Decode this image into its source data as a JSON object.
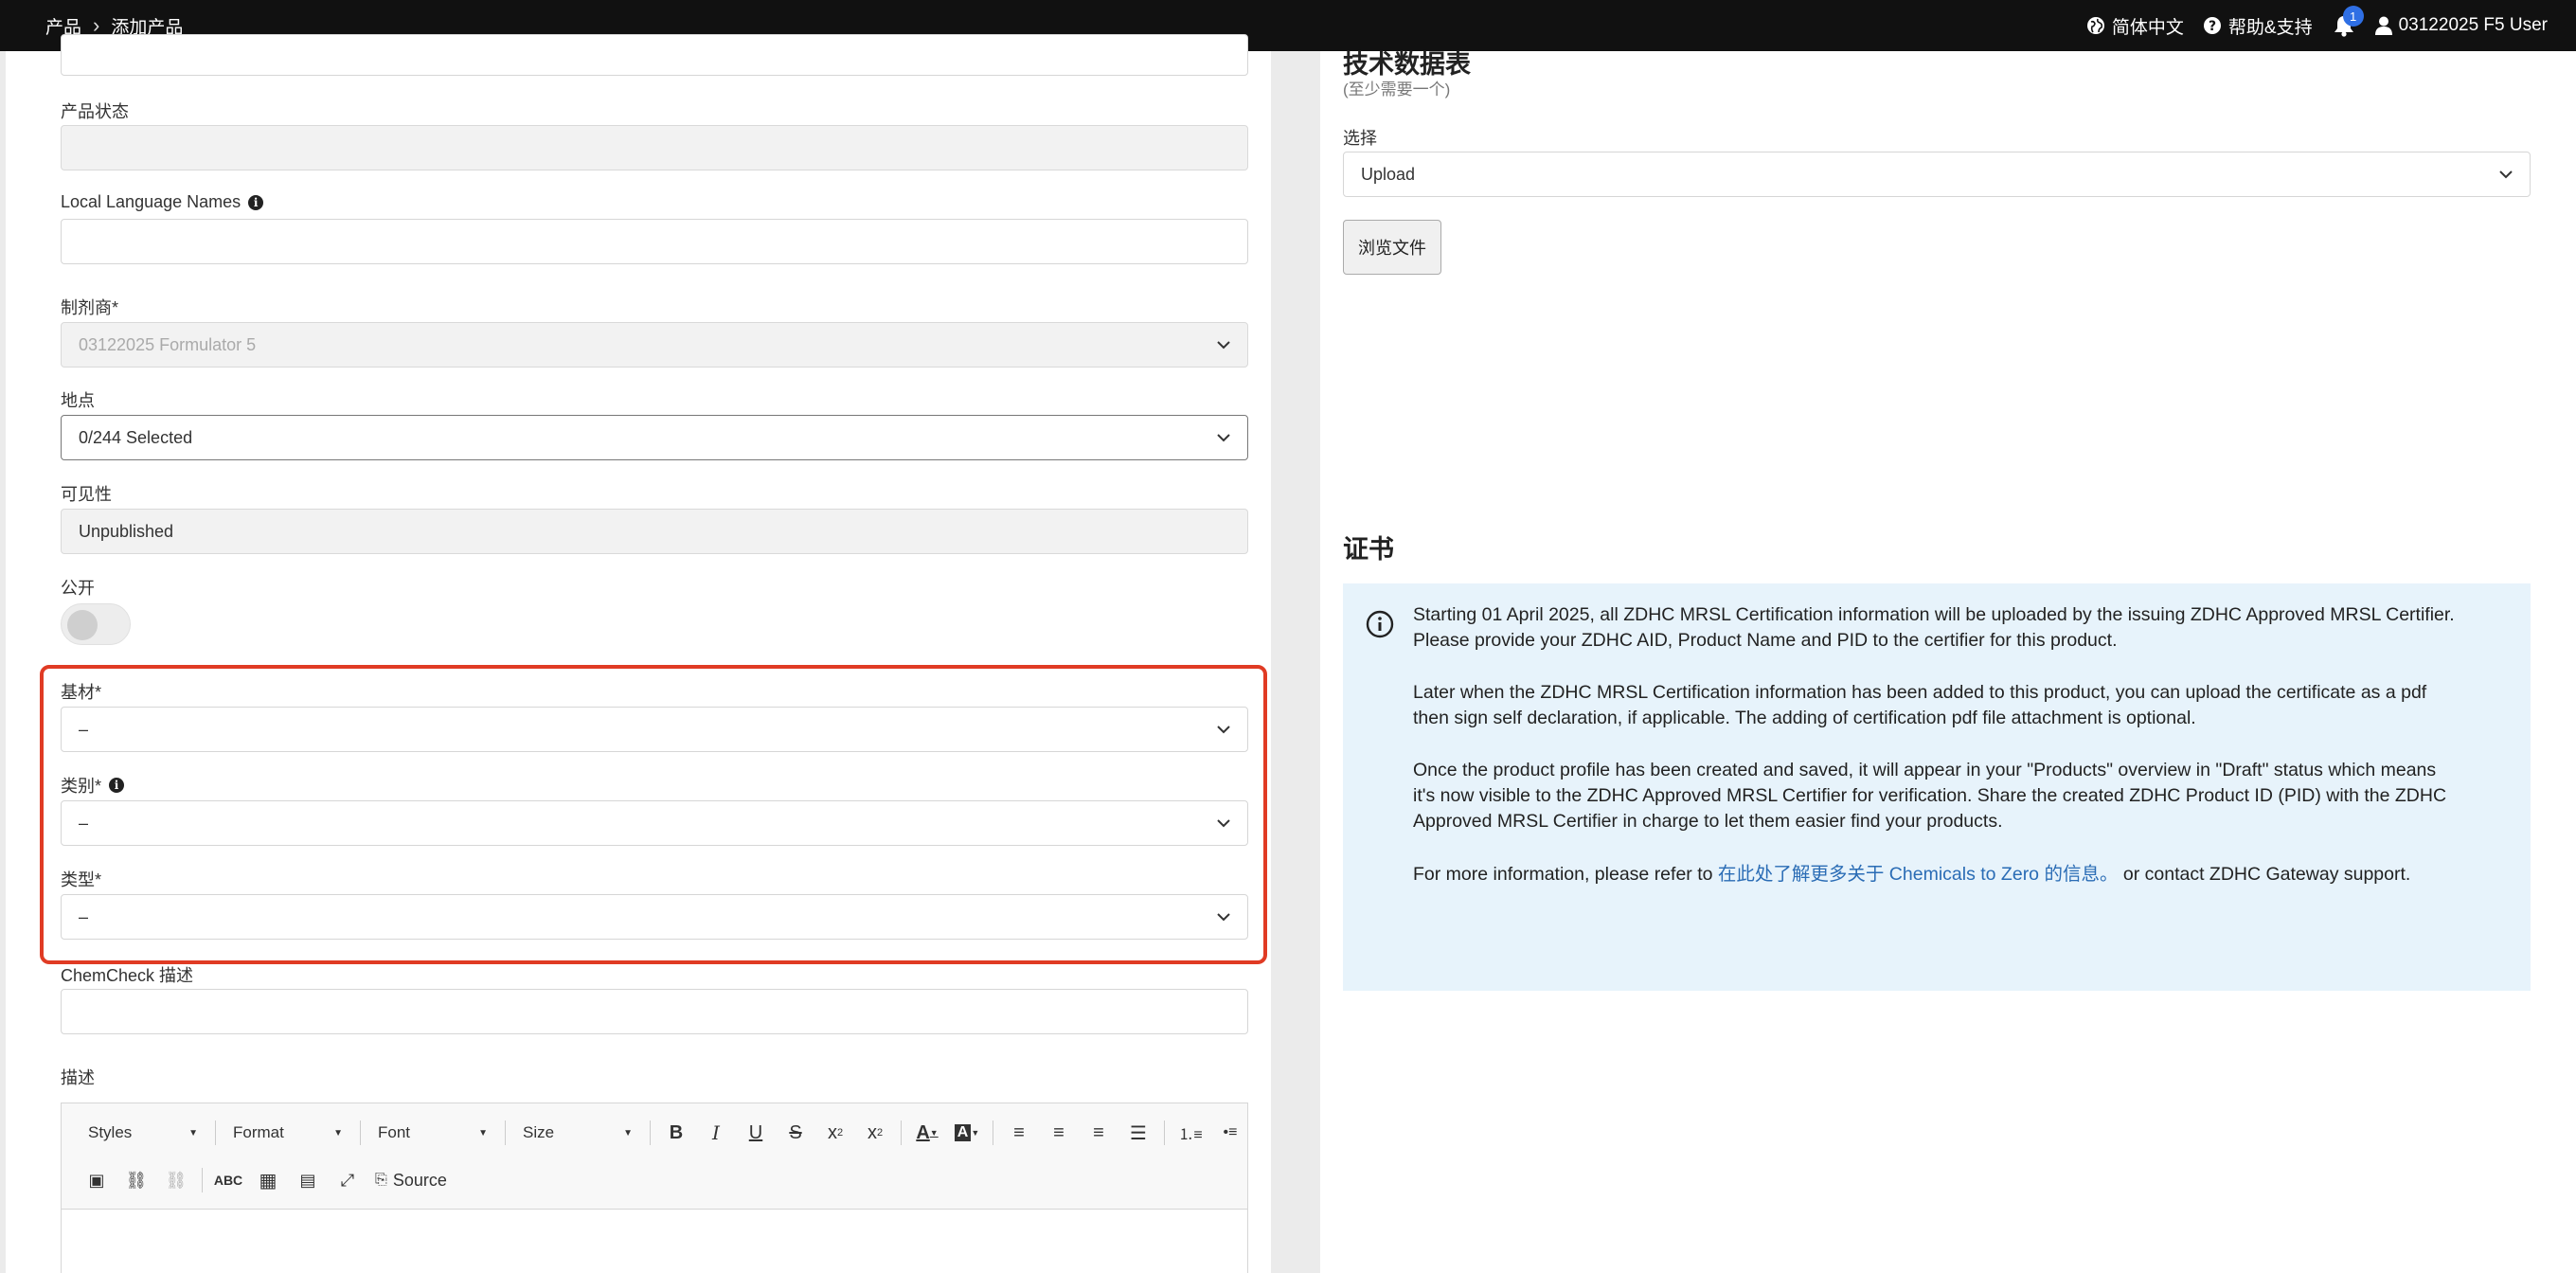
{
  "header": {
    "breadcrumb": [
      "产品",
      "添加产品"
    ],
    "language": "简体中文",
    "help": "帮助&支持",
    "notification_count": "1",
    "user": "03122025 F5 User"
  },
  "form": {
    "product_status_label": "产品状态",
    "local_names_label": "Local Language Names",
    "formulator_label": "制剂商*",
    "formulator_value": "03122025 Formulator 5",
    "location_label": "地点",
    "location_value": "0/244 Selected",
    "visibility_label": "可见性",
    "visibility_value": "Unpublished",
    "public_label": "公开",
    "substrate_label": "基材*",
    "substrate_value": "–",
    "category_label": "类别*",
    "category_value": "–",
    "type_label": "类型*",
    "type_value": "–",
    "chemcheck_label": "ChemCheck 描述",
    "description_label": "描述"
  },
  "editor": {
    "styles": "Styles",
    "format": "Format",
    "font": "Font",
    "size": "Size",
    "source": "Source"
  },
  "tds": {
    "title": "技术数据表",
    "subtitle": "(至少需要一个)",
    "select_label": "选择",
    "select_value": "Upload",
    "browse": "浏览文件"
  },
  "cert": {
    "title": "证书",
    "p1": "Starting 01 April 2025, all ZDHC MRSL Certification information will be uploaded by the issuing ZDHC Approved MRSL Certifier. Please provide your ZDHC AID, Product Name and PID to the certifier for this product.",
    "p2": "Later when the ZDHC MRSL Certification information has been added to this product, you can upload the certificate as a pdf then sign self declaration, if applicable. The adding of certification pdf file attachment is optional.",
    "p3": "Once the product profile has been created and saved, it will appear in your \"Products\" overview in \"Draft\" status which means it's now visible to the ZDHC Approved MRSL Certifier for verification. Share the created ZDHC Product ID (PID) with the ZDHC Approved MRSL Certifier in charge to let them easier find your products.",
    "p4_prefix": "For more information, please refer to ",
    "p4_link": "在此处了解更多关于 Chemicals to Zero 的信息。",
    "p4_suffix": " or contact ZDHC Gateway support."
  }
}
